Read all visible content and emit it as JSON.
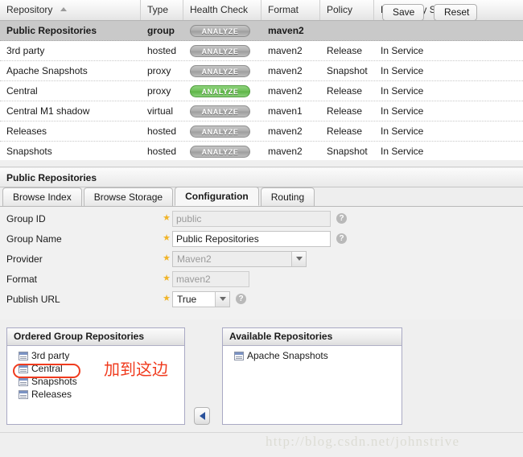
{
  "grid": {
    "columns": [
      {
        "key": "repository",
        "label": "Repository",
        "sorted": "asc"
      },
      {
        "key": "type",
        "label": "Type"
      },
      {
        "key": "health",
        "label": "Health Check"
      },
      {
        "key": "format",
        "label": "Format"
      },
      {
        "key": "policy",
        "label": "Policy"
      },
      {
        "key": "status",
        "label": "Repository Status"
      }
    ],
    "analyze_label": "ANALYZE",
    "rows": [
      {
        "repository": "Public Repositories",
        "type": "group",
        "health": "gray",
        "format": "maven2",
        "policy": "",
        "status": "",
        "selected": true
      },
      {
        "repository": "3rd party",
        "type": "hosted",
        "health": "gray",
        "format": "maven2",
        "policy": "Release",
        "status": "In Service",
        "selected": false
      },
      {
        "repository": "Apache Snapshots",
        "type": "proxy",
        "health": "gray",
        "format": "maven2",
        "policy": "Snapshot",
        "status": "In Service",
        "selected": false
      },
      {
        "repository": "Central",
        "type": "proxy",
        "health": "green",
        "format": "maven2",
        "policy": "Release",
        "status": "In Service",
        "selected": false
      },
      {
        "repository": "Central M1 shadow",
        "type": "virtual",
        "health": "gray",
        "format": "maven1",
        "policy": "Release",
        "status": "In Service",
        "selected": false
      },
      {
        "repository": "Releases",
        "type": "hosted",
        "health": "gray",
        "format": "maven2",
        "policy": "Release",
        "status": "In Service",
        "selected": false
      },
      {
        "repository": "Snapshots",
        "type": "hosted",
        "health": "gray",
        "format": "maven2",
        "policy": "Snapshot",
        "status": "In Service",
        "selected": false
      }
    ]
  },
  "panel": {
    "title": "Public Repositories",
    "tabs": [
      {
        "label": "Browse Index",
        "active": false
      },
      {
        "label": "Browse Storage",
        "active": false
      },
      {
        "label": "Configuration",
        "active": true
      },
      {
        "label": "Routing",
        "active": false
      }
    ]
  },
  "form": {
    "group_id": {
      "label": "Group ID",
      "value": "public",
      "readonly": true,
      "help": true
    },
    "group_name": {
      "label": "Group Name",
      "value": "Public Repositories",
      "readonly": false,
      "help": true
    },
    "provider": {
      "label": "Provider",
      "value": "Maven2",
      "readonly": true,
      "help": false
    },
    "format": {
      "label": "Format",
      "value": "maven2",
      "readonly": true,
      "help": false
    },
    "publish_url": {
      "label": "Publish URL",
      "value": "True",
      "readonly": false,
      "help": true
    },
    "help_glyph": "?",
    "star_glyph": "★"
  },
  "lists": {
    "ordered": {
      "title": "Ordered Group Repositories",
      "items": [
        "3rd party",
        "Central",
        "Snapshots",
        "Releases"
      ]
    },
    "available": {
      "title": "Available Repositories",
      "items": [
        "Apache Snapshots"
      ]
    },
    "move_button": "move-left-arrow"
  },
  "annotation": {
    "text": "加到这边",
    "color": "#f03b1e",
    "highlighted_item": "Central"
  },
  "footer": {
    "save_label": "Save",
    "reset_label": "Reset",
    "watermark": "http://blog.csdn.net/johnstrive"
  }
}
